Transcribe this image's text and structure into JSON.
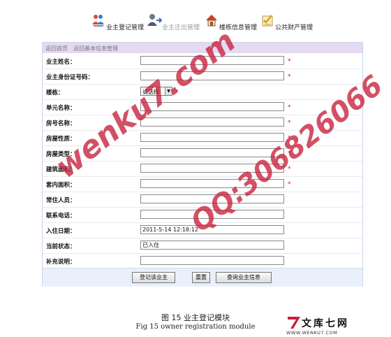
{
  "nav": {
    "items": [
      {
        "label": "业主登记管理",
        "icon": "people-icon",
        "state": "active"
      },
      {
        "label": "业主迁出管理",
        "icon": "user-move-icon",
        "state": "dimmed"
      },
      {
        "label": "楼栋信息管理",
        "icon": "house-icon",
        "state": "active"
      },
      {
        "label": "公共财产管理",
        "icon": "checklist-icon",
        "state": "active"
      }
    ]
  },
  "breadcrumb": {
    "home": "返回首页",
    "basic": "返回基本信息管理"
  },
  "form": {
    "owner_name": {
      "label": "业主姓名：",
      "value": "",
      "required": "*"
    },
    "id_number": {
      "label": "业主身份证号码：",
      "value": "",
      "required": "*"
    },
    "building": {
      "label": "楼栋：",
      "selected": "请选择",
      "required": "*"
    },
    "unit_name": {
      "label": "单元名称：",
      "value": "",
      "required": "*"
    },
    "room_name": {
      "label": "房号名称：",
      "value": "",
      "required": "*"
    },
    "house_nature": {
      "label": "房屋性质：",
      "value": "",
      "required": "*"
    },
    "house_type": {
      "label": "房屋类型：",
      "value": "",
      "required": "*"
    },
    "build_area": {
      "label": "建筑面积：",
      "value": "",
      "required": "*"
    },
    "inner_area": {
      "label": "套内面积：",
      "value": "",
      "required": "*"
    },
    "residents": {
      "label": "常住人员：",
      "value": ""
    },
    "phone": {
      "label": "联系电话：",
      "value": ""
    },
    "move_in_date": {
      "label": "入住日期：",
      "value": "2011-5-14 12:18:12"
    },
    "status": {
      "label": "当前状态：",
      "value": "已入住"
    },
    "remark": {
      "label": "补充说明：",
      "value": ""
    }
  },
  "buttons": {
    "register": "登记该业主",
    "reset": "重置",
    "query": "查询业主信息"
  },
  "caption": {
    "cn": "图 15 业主登记模块",
    "en": "Fig 15 owner registration module"
  },
  "watermark": {
    "site": "wenku7.com",
    "qq": "QQ:306826066"
  },
  "logo": {
    "name": "文库七网",
    "url": "WWW.WENKU7.COM"
  },
  "colors": {
    "required": "#d01010",
    "breadcrumb_bg": "#e6d9f2",
    "watermark": "#c7203a",
    "button_bar": "#eaf0fb"
  }
}
